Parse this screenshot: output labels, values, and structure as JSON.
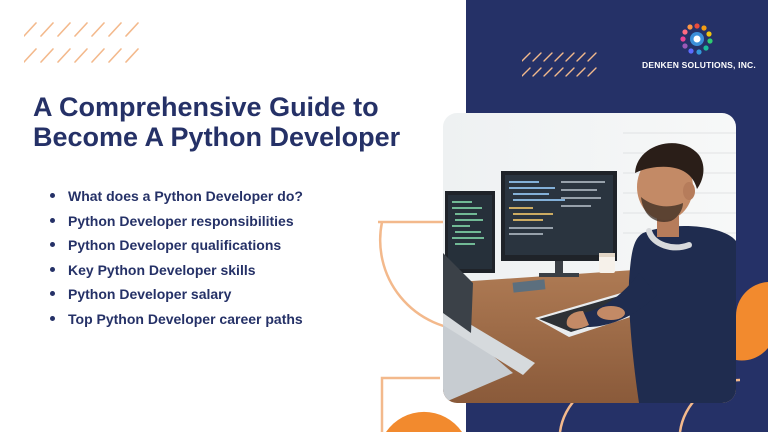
{
  "slide": {
    "title_line1": "A Comprehensive Guide to",
    "title_line2": "Become A Python Developer",
    "bullets": [
      "What does a Python Developer do?",
      "Python Developer responsibilities",
      "Python Developer qualifications",
      "Key Python Developer skills",
      "Python Developer salary",
      "Top Python Developer career paths"
    ]
  },
  "brand": {
    "logo_text": "DENKEN SOLUTIONS, INC.",
    "logo_icon": "colorful-dots-circle-icon"
  },
  "photo": {
    "subject": "developer-at-desk-photo"
  },
  "colors": {
    "navy": "#253167",
    "orange": "#f28a2e",
    "peach": "#f3b98c",
    "white": "#ffffff"
  }
}
